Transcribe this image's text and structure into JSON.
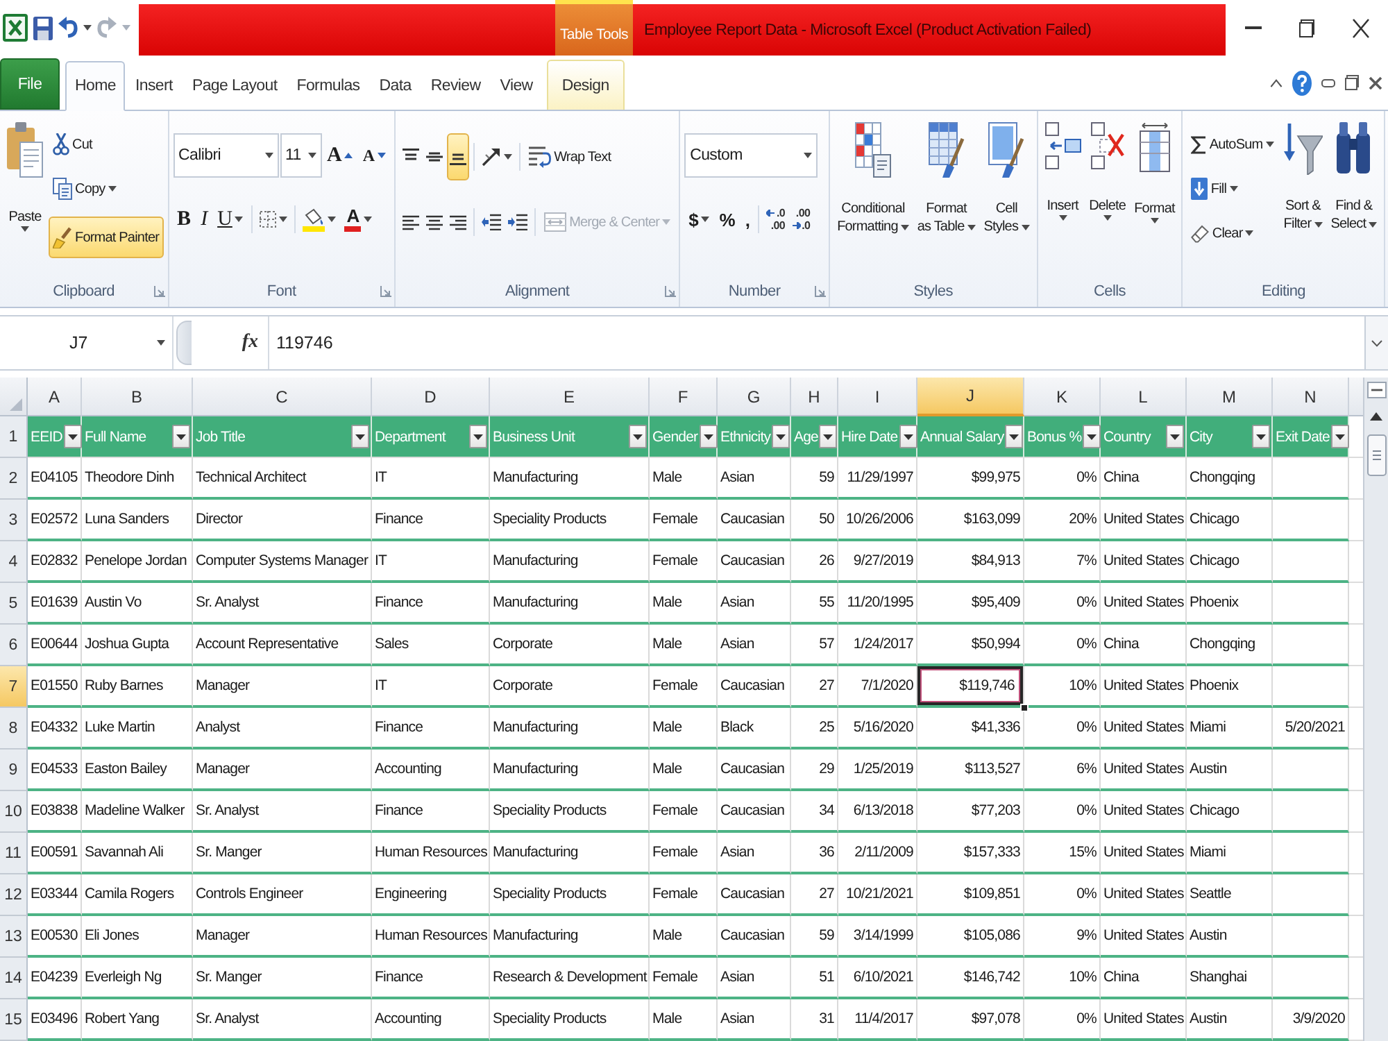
{
  "title_bar": {
    "context_label": "Table Tools",
    "title": "Employee Report Data - Microsoft Excel (Product Activation Failed)"
  },
  "ribbon_tabs": [
    {
      "label": "File",
      "kind": "file",
      "selected": false
    },
    {
      "label": "Home",
      "kind": "standard",
      "selected": true
    },
    {
      "label": "Insert",
      "kind": "standard",
      "selected": false
    },
    {
      "label": "Page Layout",
      "kind": "standard",
      "selected": false
    },
    {
      "label": "Formulas",
      "kind": "standard",
      "selected": false
    },
    {
      "label": "Data",
      "kind": "standard",
      "selected": false
    },
    {
      "label": "Review",
      "kind": "standard",
      "selected": false
    },
    {
      "label": "View",
      "kind": "standard",
      "selected": false
    },
    {
      "label": "Design",
      "kind": "contextual",
      "selected": false
    }
  ],
  "ribbon": {
    "clipboard": {
      "label": "Clipboard",
      "dialog_launcher": true,
      "paste": "Paste",
      "cut": "Cut",
      "copy": "Copy",
      "format_painter": {
        "label": "Format Painter",
        "pressed": true
      }
    },
    "font": {
      "label": "Font",
      "dialog_launcher": true,
      "font_name": "Calibri",
      "font_size": "11",
      "grow_font": "A",
      "shrink_font": "A",
      "bold": "B",
      "italic": "I",
      "underline": "U",
      "font_color": "A"
    },
    "alignment": {
      "label": "Alignment",
      "dialog_launcher": true,
      "vertical_align": [
        {
          "kind": "top",
          "selected": false
        },
        {
          "kind": "middle",
          "selected": false
        },
        {
          "kind": "bottom",
          "selected": true
        }
      ],
      "wrap_text": "Wrap Text",
      "merge_center": {
        "label": "Merge & Center",
        "disabled": true
      }
    },
    "number": {
      "label": "Number",
      "dialog_launcher": true,
      "format": "Custom",
      "currency": "$",
      "percent": "%",
      "comma": ",",
      "increase_decimal": [
        ".0",
        ".00"
      ],
      "decrease_decimal": [
        ".00",
        ".0"
      ]
    },
    "styles": {
      "label": "Styles",
      "buttons": [
        {
          "kind": "conditional_formatting",
          "lines": [
            "Conditional",
            "Formatting"
          ]
        },
        {
          "kind": "format_as_table",
          "lines": [
            "Format",
            "as Table"
          ]
        },
        {
          "kind": "cell_styles",
          "lines": [
            "Cell",
            "Styles"
          ]
        }
      ]
    },
    "cells": {
      "label": "Cells",
      "buttons": [
        {
          "kind": "insert",
          "label": "Insert"
        },
        {
          "kind": "delete",
          "label": "Delete"
        },
        {
          "kind": "format",
          "label": "Format"
        }
      ]
    },
    "editing": {
      "label": "Editing",
      "autosum": "AutoSum",
      "fill": "Fill",
      "clear": "Clear",
      "sort_filter": [
        "Sort &",
        "Filter"
      ],
      "find_select": [
        "Find &",
        "Select"
      ]
    }
  },
  "formula_bar": {
    "name_box": "J7",
    "insert_function": "fx",
    "formula": "119746"
  },
  "sheet": {
    "columns": [
      {
        "label": "A",
        "kind": "text",
        "selected": false
      },
      {
        "label": "B",
        "kind": "text",
        "selected": false
      },
      {
        "label": "C",
        "kind": "text",
        "selected": false
      },
      {
        "label": "D",
        "kind": "text",
        "selected": false
      },
      {
        "label": "E",
        "kind": "text",
        "selected": false
      },
      {
        "label": "F",
        "kind": "text",
        "selected": false
      },
      {
        "label": "G",
        "kind": "text",
        "selected": false
      },
      {
        "label": "H",
        "kind": "number",
        "selected": false
      },
      {
        "label": "I",
        "kind": "number",
        "selected": false
      },
      {
        "label": "J",
        "kind": "number",
        "selected": true
      },
      {
        "label": "K",
        "kind": "number",
        "selected": false
      },
      {
        "label": "L",
        "kind": "text",
        "selected": false
      },
      {
        "label": "M",
        "kind": "text",
        "selected": false
      },
      {
        "label": "N",
        "kind": "number",
        "selected": false
      }
    ],
    "header_row": {
      "number": "1",
      "cells": [
        "EEID",
        "Full Name",
        "Job Title",
        "Department",
        "Business Unit",
        "Gender",
        "Ethnicity",
        "Age",
        "Hire Date",
        "Annual Salary",
        "Bonus %",
        "Country",
        "City",
        "Exit Date"
      ]
    },
    "rows": [
      {
        "number": "2",
        "selected": false,
        "cells": [
          "E04105",
          "Theodore Dinh",
          "Technical Architect",
          "IT",
          "Manufacturing",
          "Male",
          "Asian",
          "59",
          "11/29/1997",
          "$99,975",
          "0%",
          "China",
          "Chongqing"
        ]
      },
      {
        "number": "3",
        "selected": false,
        "cells": [
          "E02572",
          "Luna Sanders",
          "Director",
          "Finance",
          "Speciality Products",
          "Female",
          "Caucasian",
          "50",
          "10/26/2006",
          "$163,099",
          "20%",
          "United States",
          "Chicago"
        ]
      },
      {
        "number": "4",
        "selected": false,
        "cells": [
          "E02832",
          "Penelope Jordan",
          "Computer Systems Manager",
          "IT",
          "Manufacturing",
          "Female",
          "Caucasian",
          "26",
          "9/27/2019",
          "$84,913",
          "7%",
          "United States",
          "Chicago"
        ]
      },
      {
        "number": "5",
        "selected": false,
        "cells": [
          "E01639",
          "Austin Vo",
          "Sr. Analyst",
          "Finance",
          "Manufacturing",
          "Male",
          "Asian",
          "55",
          "11/20/1995",
          "$95,409",
          "0%",
          "United States",
          "Phoenix"
        ]
      },
      {
        "number": "6",
        "selected": false,
        "cells": [
          "E00644",
          "Joshua Gupta",
          "Account Representative",
          "Sales",
          "Corporate",
          "Male",
          "Asian",
          "57",
          "1/24/2017",
          "$50,994",
          "0%",
          "China",
          "Chongqing"
        ]
      },
      {
        "number": "7",
        "selected": true,
        "cells": [
          "E01550",
          "Ruby Barnes",
          "Manager",
          "IT",
          "Corporate",
          "Female",
          "Caucasian",
          "27",
          "7/1/2020",
          "$119,746",
          "10%",
          "United States",
          "Phoenix"
        ]
      },
      {
        "number": "8",
        "selected": false,
        "cells": [
          "E04332",
          "Luke Martin",
          "Analyst",
          "Finance",
          "Manufacturing",
          "Male",
          "Black",
          "25",
          "5/16/2020",
          "$41,336",
          "0%",
          "United States",
          "Miami"
        ],
        "exit_date": "5/20/2021"
      },
      {
        "number": "9",
        "selected": false,
        "cells": [
          "E04533",
          "Easton Bailey",
          "Manager",
          "Accounting",
          "Manufacturing",
          "Male",
          "Caucasian",
          "29",
          "1/25/2019",
          "$113,527",
          "6%",
          "United States",
          "Austin"
        ]
      },
      {
        "number": "10",
        "selected": false,
        "cells": [
          "E03838",
          "Madeline Walker",
          "Sr. Analyst",
          "Finance",
          "Speciality Products",
          "Female",
          "Caucasian",
          "34",
          "6/13/2018",
          "$77,203",
          "0%",
          "United States",
          "Chicago"
        ]
      },
      {
        "number": "11",
        "selected": false,
        "cells": [
          "E00591",
          "Savannah Ali",
          "Sr. Manger",
          "Human Resources",
          "Manufacturing",
          "Female",
          "Asian",
          "36",
          "2/11/2009",
          "$157,333",
          "15%",
          "United States",
          "Miami"
        ]
      },
      {
        "number": "12",
        "selected": false,
        "cells": [
          "E03344",
          "Camila Rogers",
          "Controls Engineer",
          "Engineering",
          "Speciality Products",
          "Female",
          "Caucasian",
          "27",
          "10/21/2021",
          "$109,851",
          "0%",
          "United States",
          "Seattle"
        ]
      },
      {
        "number": "13",
        "selected": false,
        "cells": [
          "E00530",
          "Eli Jones",
          "Manager",
          "Human Resources",
          "Manufacturing",
          "Male",
          "Caucasian",
          "59",
          "3/14/1999",
          "$105,086",
          "9%",
          "United States",
          "Austin"
        ]
      },
      {
        "number": "14",
        "selected": false,
        "cells": [
          "E04239",
          "Everleigh Ng",
          "Sr. Manger",
          "Finance",
          "Research & Development",
          "Female",
          "Asian",
          "51",
          "6/10/2021",
          "$146,742",
          "10%",
          "China",
          "Shanghai"
        ]
      },
      {
        "number": "15",
        "selected": false,
        "cells": [
          "E03496",
          "Robert Yang",
          "Sr. Analyst",
          "Accounting",
          "Speciality Products",
          "Male",
          "Asian",
          "31",
          "11/4/2017",
          "$97,078",
          "0%",
          "United States",
          "Austin"
        ],
        "exit_date": "3/9/2020"
      }
    ]
  }
}
